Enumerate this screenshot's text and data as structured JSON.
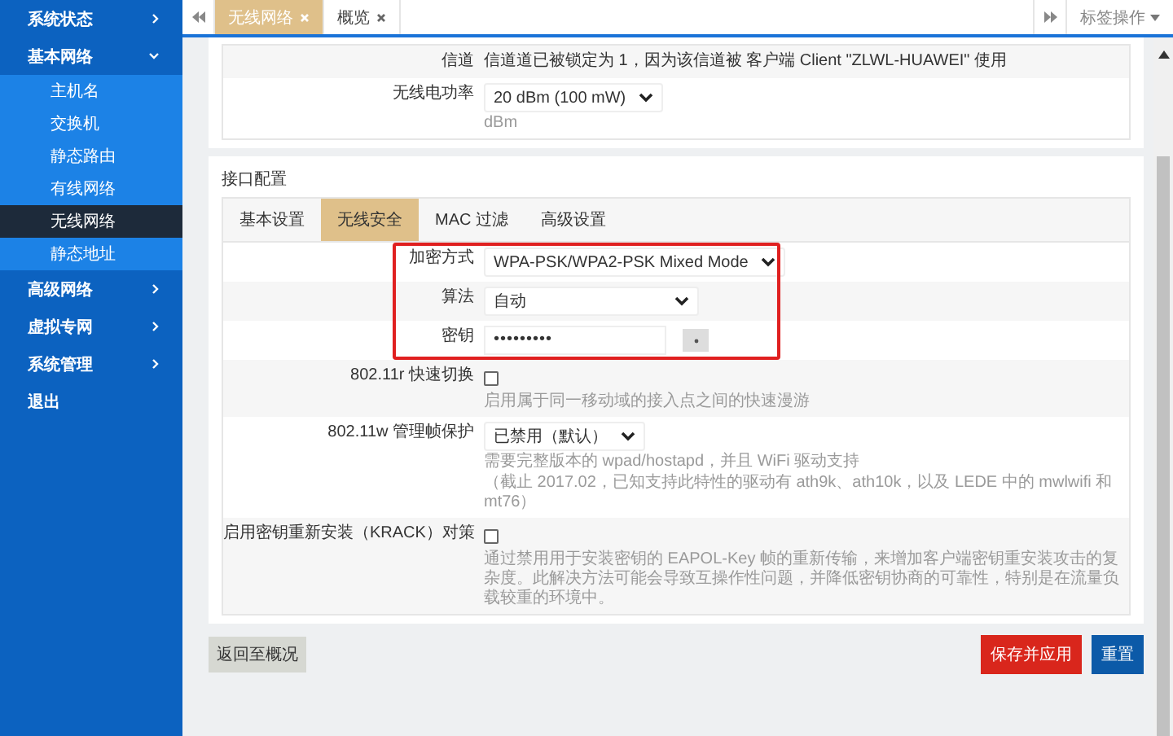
{
  "sidebar": {
    "items": [
      {
        "kind": "group",
        "label": "系统状态",
        "expanded": false
      },
      {
        "kind": "group",
        "label": "基本网络",
        "expanded": true,
        "children": [
          {
            "label": "主机名",
            "selected": false
          },
          {
            "label": "交换机",
            "selected": false
          },
          {
            "label": "静态路由",
            "selected": false
          },
          {
            "label": "有线网络",
            "selected": false
          },
          {
            "label": "无线网络",
            "selected": true
          },
          {
            "label": "静态地址",
            "selected": false
          }
        ]
      },
      {
        "kind": "group",
        "label": "高级网络",
        "expanded": false
      },
      {
        "kind": "group",
        "label": "虚拟专网",
        "expanded": false
      },
      {
        "kind": "group",
        "label": "系统管理",
        "expanded": false
      },
      {
        "kind": "link",
        "label": "退出"
      }
    ]
  },
  "tab_bar": {
    "tabs": [
      {
        "label": "无线网络",
        "selected": true
      },
      {
        "label": "概览",
        "selected": false
      }
    ],
    "actions_label": "标签操作"
  },
  "device_card": {
    "fields": [
      {
        "kind": "text",
        "label": "信道",
        "value": "信道道已被锁定为 1，因为该信道被 客户端 Client \"ZLWL-HUAWEI\" 使用"
      },
      {
        "kind": "select",
        "label": "无线电功率",
        "value": "20 dBm (100 mW)",
        "hints": [
          "dBm"
        ]
      }
    ]
  },
  "interface_card": {
    "title": "接口配置",
    "tabs": [
      {
        "label": "基本设置",
        "selected": false
      },
      {
        "label": "无线安全",
        "selected": true
      },
      {
        "label": "MAC 过滤",
        "selected": false
      },
      {
        "label": "高级设置",
        "selected": false
      }
    ],
    "highlight_box": {
      "fields": [
        {
          "kind": "select",
          "label": "加密方式",
          "value": "WPA-PSK/WPA2-PSK Mixed Mode"
        },
        {
          "kind": "select",
          "label": "算法",
          "value": "自动"
        },
        {
          "kind": "password",
          "label": "密钥",
          "value": "•••••••••"
        }
      ]
    },
    "fields": [
      {
        "kind": "checkbox",
        "label": "802.11r 快速切换",
        "checked": false,
        "hints": [
          "启用属于同一移动域的接入点之间的快速漫游"
        ]
      },
      {
        "kind": "select",
        "label": "802.11w 管理帧保护",
        "value": "已禁用（默认）",
        "hints": [
          "需要完整版本的 wpad/hostapd，并且 WiFi 驱动支持",
          "（截止 2017.02，已知支持此特性的驱动有 ath9k、ath10k，以及 LEDE 中的 mwlwifi 和 mt76）"
        ]
      },
      {
        "kind": "checkbox",
        "label": "启用密钥重新安装（KRACK）对策",
        "checked": false,
        "hints": [
          "通过禁用用于安装密钥的 EAPOL-Key 帧的重新传输，来增加客户端密钥重安装攻击的复杂度。此解决方法可能会导致互操作性问题，并降低密钥协商的可靠性，特别是在流量负载较重的环境中。"
        ]
      }
    ]
  },
  "footer": {
    "back_button": "返回至概况",
    "save_button": "保存并应用",
    "reset_button": "重置"
  }
}
